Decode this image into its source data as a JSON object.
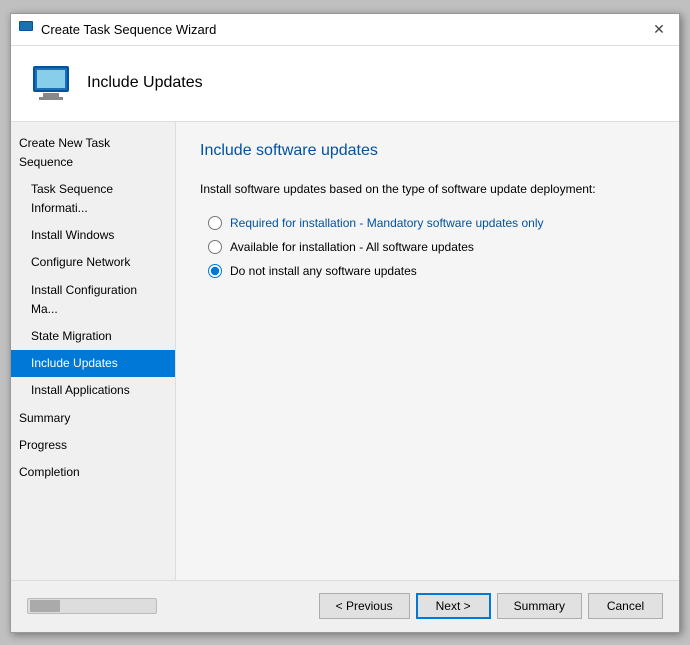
{
  "window": {
    "title": "Create Task Sequence Wizard",
    "close_btn": "✕"
  },
  "header": {
    "title": "Include Updates"
  },
  "sidebar": {
    "items": [
      {
        "id": "create-new",
        "label": "Create New Task Sequence",
        "level": "category",
        "active": false
      },
      {
        "id": "task-info",
        "label": "Task Sequence Informati...",
        "level": "sub",
        "active": false
      },
      {
        "id": "install-windows",
        "label": "Install Windows",
        "level": "sub",
        "active": false
      },
      {
        "id": "configure-network",
        "label": "Configure Network",
        "level": "sub",
        "active": false
      },
      {
        "id": "install-config-mgr",
        "label": "Install Configuration Ma...",
        "level": "sub",
        "active": false
      },
      {
        "id": "state-migration",
        "label": "State Migration",
        "level": "sub",
        "active": false
      },
      {
        "id": "include-updates",
        "label": "Include Updates",
        "level": "sub",
        "active": true
      },
      {
        "id": "install-applications",
        "label": "Install Applications",
        "level": "sub",
        "active": false
      }
    ],
    "bottom_items": [
      {
        "id": "summary",
        "label": "Summary",
        "level": "category",
        "active": false
      },
      {
        "id": "progress",
        "label": "Progress",
        "level": "category",
        "active": false
      },
      {
        "id": "completion",
        "label": "Completion",
        "level": "category",
        "active": false
      }
    ]
  },
  "content": {
    "title": "Include software updates",
    "description": "Install software updates based on the type of software update deployment:",
    "radio_options": [
      {
        "id": "required",
        "label": "Required for installation - Mandatory software updates only",
        "checked": false,
        "link": true
      },
      {
        "id": "available",
        "label": "Available for installation - All software updates",
        "checked": false,
        "link": false
      },
      {
        "id": "none",
        "label": "Do not install any software updates",
        "checked": true,
        "link": false
      }
    ]
  },
  "footer": {
    "previous_label": "< Previous",
    "next_label": "Next >",
    "summary_label": "Summary",
    "cancel_label": "Cancel"
  }
}
